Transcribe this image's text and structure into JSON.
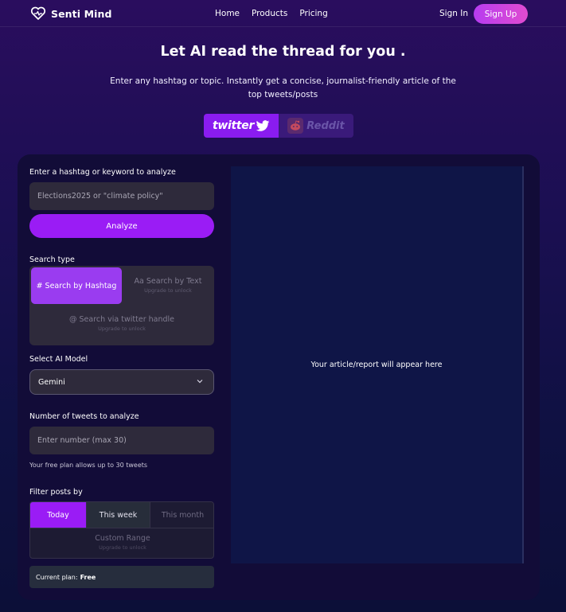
{
  "nav": {
    "brand": "Senti Mind",
    "links": [
      "Home",
      "Products",
      "Pricing"
    ],
    "signin": "Sign In",
    "signup": "Sign Up"
  },
  "hero": {
    "title": "Let AI read the thread for you .",
    "subtitle": "Enter any hashtag or topic. Instantly get a concise, journalist-friendly article of the top tweets/posts"
  },
  "platforms": {
    "twitter": "twitter",
    "reddit": "Reddit",
    "selected": "twitter"
  },
  "form": {
    "keyword_label": "Enter a hashtag or keyword to analyze",
    "keyword_placeholder": "Elections2025 or \"climate policy\"",
    "analyze_button": "Analyze",
    "search_type_label": "Search type",
    "search_types": {
      "hashtag": "# Search by Hashtag",
      "text": "Aa Search by Text",
      "text_note": "Upgrade to unlock",
      "handle": "@ Search via twitter handle",
      "handle_note": "Upgrade to unlock"
    },
    "model_label": "Select AI Model",
    "model_value": "Gemini",
    "count_label": "Number of tweets to analyze",
    "count_placeholder": "Enter number (max 30)",
    "count_hint": "Your free plan allows up to 30 tweets",
    "filter_label": "Filter posts by",
    "filters": {
      "today": "Today",
      "week": "This week",
      "month": "This month",
      "custom": "Custom Range",
      "custom_note": "Upgrade to unlock"
    },
    "plan_label": "Current plan:",
    "plan_value": "Free"
  },
  "output": {
    "placeholder": "Your article/report will appear here"
  },
  "colors": {
    "accent": "#9a1cf5",
    "signup_gradient": [
      "#b73cf0",
      "#e04bd0"
    ],
    "panel": "#2e2a3b"
  }
}
